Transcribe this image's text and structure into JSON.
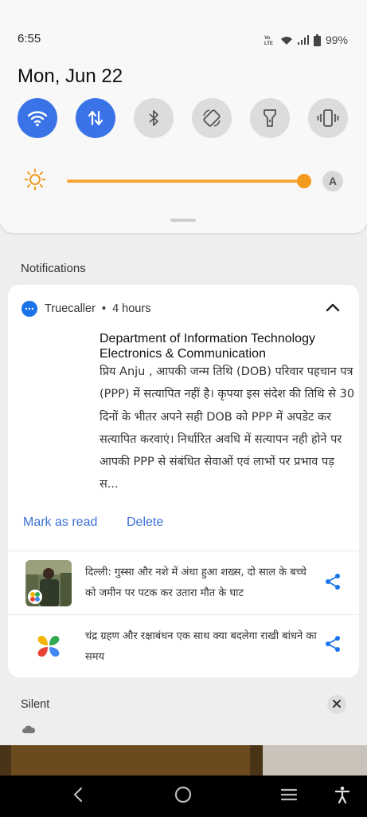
{
  "status_bar": {
    "time": "6:55",
    "volte_label": "Vo LTE",
    "battery": "99%"
  },
  "quick_settings": {
    "date": "Mon, Jun 22",
    "tiles": [
      {
        "icon": "wifi-icon",
        "active": true
      },
      {
        "icon": "mobile-data-icon",
        "active": true
      },
      {
        "icon": "bluetooth-icon",
        "active": false
      },
      {
        "icon": "auto-rotate-icon",
        "active": false
      },
      {
        "icon": "flashlight-icon",
        "active": false
      },
      {
        "icon": "vibrate-icon",
        "active": false
      }
    ],
    "brightness": {
      "level": 1.0,
      "auto_label": "A",
      "accent": "#f39a1e"
    }
  },
  "notifications": {
    "header": "Notifications",
    "truecaller": {
      "app_name": "Truecaller",
      "separator": "•",
      "time_ago": "4 hours",
      "sender": "Department of Information Technology Electronics & Communication",
      "body": "प्रिय Anju , आपकी जन्म तिथि (DOB) परिवार पहचान पत्र (PPP) में सत्यापित नहीं है। कृपया इस संदेश की तिथि से 30 दिनों के भीतर अपने सही DOB को PPP में अपडेट कर सत्यापित करवाएं। निर्धारित अवधि में सत्यापन नही होने पर आपकी PPP से संबंधित सेवाओं एवं लाभों पर प्रभाव पड़ स...",
      "mark_as_read": "Mark as read",
      "delete": "Delete"
    },
    "news": [
      {
        "text": "दिल्ली: गुस्सा और नशे में अंधा हुआ शख्स, दो साल के बच्चे को जमीन पर पटक कर उतारा मौत के घाट"
      },
      {
        "text": "चंद्र ग्रहण और रक्षाबंधन एक साथ क्या बदलेगा राखी बांधने का समय"
      }
    ],
    "silent_header": "Silent"
  },
  "colors": {
    "accent_blue": "#3a73e8",
    "link_blue": "#3b6fd6",
    "brightness_orange": "#f39a1e"
  }
}
